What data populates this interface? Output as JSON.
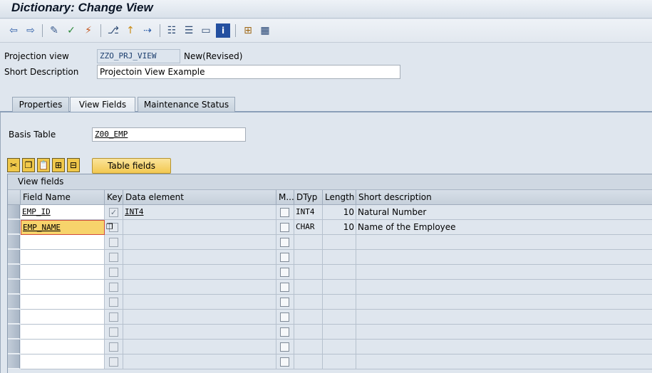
{
  "window": {
    "title": "Dictionary: Change View"
  },
  "toolbar": {
    "icons": [
      "back-arrow-icon",
      "forward-arrow-icon",
      "pencil-icon",
      "check-icon",
      "activate-icon",
      "where-used-icon",
      "other-object-icon",
      "display-object-list-icon",
      "hierarchy-icon",
      "navigation-window-icon",
      "display-icon",
      "info-icon",
      "structure-icon",
      "table-grid-icon"
    ]
  },
  "header": {
    "projection_view_label": "Projection view",
    "projection_view_value": "ZZO_PRJ_VIEW",
    "status": "New(Revised)",
    "short_desc_label": "Short Description",
    "short_desc_value": "Projectoin View Example"
  },
  "tabs": [
    {
      "label": "Properties"
    },
    {
      "label": "View Fields"
    },
    {
      "label": "Maintenance Status"
    }
  ],
  "basis": {
    "label": "Basis Table",
    "value": "Z00_EMP"
  },
  "grid_toolbar": {
    "icons": [
      "cut-icon",
      "copy-icon",
      "paste-icon",
      "insert-row-icon",
      "delete-row-icon"
    ],
    "table_fields_button": "Table fields"
  },
  "grid": {
    "title": "View fields",
    "columns": [
      "Field Name",
      "Key",
      "Data element",
      "M...",
      "DTyp",
      "Length",
      "Short description"
    ],
    "rows": [
      {
        "field": "EMP_ID",
        "key": true,
        "element": "INT4",
        "m": false,
        "dtyp": "INT4",
        "length": "10",
        "desc": "Natural Number"
      },
      {
        "field": "EMP_NAME",
        "key": false,
        "element": "",
        "m": false,
        "dtyp": "CHAR",
        "length": "10",
        "desc": "Name of the Employee"
      }
    ],
    "empty_rows": 9
  }
}
